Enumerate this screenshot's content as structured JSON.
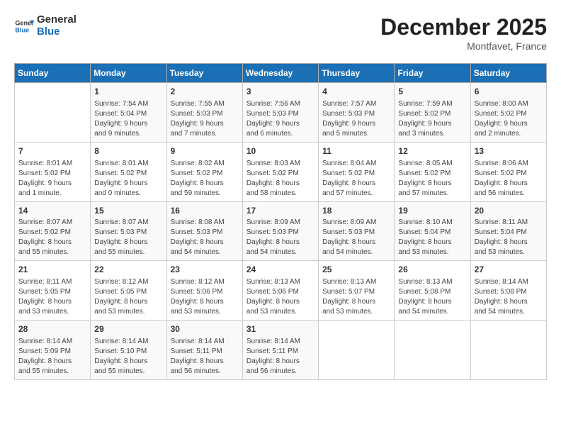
{
  "header": {
    "logo_line1": "General",
    "logo_line2": "Blue",
    "title": "December 2025",
    "subtitle": "Montfavet, France"
  },
  "weekdays": [
    "Sunday",
    "Monday",
    "Tuesday",
    "Wednesday",
    "Thursday",
    "Friday",
    "Saturday"
  ],
  "weeks": [
    [
      {
        "day": "",
        "details": ""
      },
      {
        "day": "1",
        "details": "Sunrise: 7:54 AM\nSunset: 5:04 PM\nDaylight: 9 hours\nand 9 minutes."
      },
      {
        "day": "2",
        "details": "Sunrise: 7:55 AM\nSunset: 5:03 PM\nDaylight: 9 hours\nand 7 minutes."
      },
      {
        "day": "3",
        "details": "Sunrise: 7:56 AM\nSunset: 5:03 PM\nDaylight: 9 hours\nand 6 minutes."
      },
      {
        "day": "4",
        "details": "Sunrise: 7:57 AM\nSunset: 5:03 PM\nDaylight: 9 hours\nand 5 minutes."
      },
      {
        "day": "5",
        "details": "Sunrise: 7:59 AM\nSunset: 5:02 PM\nDaylight: 9 hours\nand 3 minutes."
      },
      {
        "day": "6",
        "details": "Sunrise: 8:00 AM\nSunset: 5:02 PM\nDaylight: 9 hours\nand 2 minutes."
      }
    ],
    [
      {
        "day": "7",
        "details": "Sunrise: 8:01 AM\nSunset: 5:02 PM\nDaylight: 9 hours\nand 1 minute."
      },
      {
        "day": "8",
        "details": "Sunrise: 8:01 AM\nSunset: 5:02 PM\nDaylight: 9 hours\nand 0 minutes."
      },
      {
        "day": "9",
        "details": "Sunrise: 8:02 AM\nSunset: 5:02 PM\nDaylight: 8 hours\nand 59 minutes."
      },
      {
        "day": "10",
        "details": "Sunrise: 8:03 AM\nSunset: 5:02 PM\nDaylight: 8 hours\nand 58 minutes."
      },
      {
        "day": "11",
        "details": "Sunrise: 8:04 AM\nSunset: 5:02 PM\nDaylight: 8 hours\nand 57 minutes."
      },
      {
        "day": "12",
        "details": "Sunrise: 8:05 AM\nSunset: 5:02 PM\nDaylight: 8 hours\nand 57 minutes."
      },
      {
        "day": "13",
        "details": "Sunrise: 8:06 AM\nSunset: 5:02 PM\nDaylight: 8 hours\nand 56 minutes."
      }
    ],
    [
      {
        "day": "14",
        "details": "Sunrise: 8:07 AM\nSunset: 5:02 PM\nDaylight: 8 hours\nand 55 minutes."
      },
      {
        "day": "15",
        "details": "Sunrise: 8:07 AM\nSunset: 5:03 PM\nDaylight: 8 hours\nand 55 minutes."
      },
      {
        "day": "16",
        "details": "Sunrise: 8:08 AM\nSunset: 5:03 PM\nDaylight: 8 hours\nand 54 minutes."
      },
      {
        "day": "17",
        "details": "Sunrise: 8:09 AM\nSunset: 5:03 PM\nDaylight: 8 hours\nand 54 minutes."
      },
      {
        "day": "18",
        "details": "Sunrise: 8:09 AM\nSunset: 5:03 PM\nDaylight: 8 hours\nand 54 minutes."
      },
      {
        "day": "19",
        "details": "Sunrise: 8:10 AM\nSunset: 5:04 PM\nDaylight: 8 hours\nand 53 minutes."
      },
      {
        "day": "20",
        "details": "Sunrise: 8:11 AM\nSunset: 5:04 PM\nDaylight: 8 hours\nand 53 minutes."
      }
    ],
    [
      {
        "day": "21",
        "details": "Sunrise: 8:11 AM\nSunset: 5:05 PM\nDaylight: 8 hours\nand 53 minutes."
      },
      {
        "day": "22",
        "details": "Sunrise: 8:12 AM\nSunset: 5:05 PM\nDaylight: 8 hours\nand 53 minutes."
      },
      {
        "day": "23",
        "details": "Sunrise: 8:12 AM\nSunset: 5:06 PM\nDaylight: 8 hours\nand 53 minutes."
      },
      {
        "day": "24",
        "details": "Sunrise: 8:13 AM\nSunset: 5:06 PM\nDaylight: 8 hours\nand 53 minutes."
      },
      {
        "day": "25",
        "details": "Sunrise: 8:13 AM\nSunset: 5:07 PM\nDaylight: 8 hours\nand 53 minutes."
      },
      {
        "day": "26",
        "details": "Sunrise: 8:13 AM\nSunset: 5:08 PM\nDaylight: 8 hours\nand 54 minutes."
      },
      {
        "day": "27",
        "details": "Sunrise: 8:14 AM\nSunset: 5:08 PM\nDaylight: 8 hours\nand 54 minutes."
      }
    ],
    [
      {
        "day": "28",
        "details": "Sunrise: 8:14 AM\nSunset: 5:09 PM\nDaylight: 8 hours\nand 55 minutes."
      },
      {
        "day": "29",
        "details": "Sunrise: 8:14 AM\nSunset: 5:10 PM\nDaylight: 8 hours\nand 55 minutes."
      },
      {
        "day": "30",
        "details": "Sunrise: 8:14 AM\nSunset: 5:11 PM\nDaylight: 8 hours\nand 56 minutes."
      },
      {
        "day": "31",
        "details": "Sunrise: 8:14 AM\nSunset: 5:11 PM\nDaylight: 8 hours\nand 56 minutes."
      },
      {
        "day": "",
        "details": ""
      },
      {
        "day": "",
        "details": ""
      },
      {
        "day": "",
        "details": ""
      }
    ]
  ]
}
